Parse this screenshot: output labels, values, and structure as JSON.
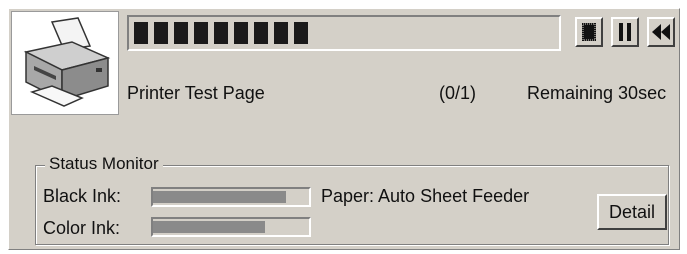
{
  "job": {
    "progress_fraction": 0.42,
    "progress_segments": 9,
    "title": "Printer Test Page",
    "count": "(0/1)",
    "remaining": "Remaining 30sec"
  },
  "controls": {
    "stop_icon": "stop-icon",
    "pause_icon": "pause-icon",
    "rewind_icon": "rewind-icon"
  },
  "status_monitor": {
    "title": "Status Monitor",
    "black_ink_label": "Black Ink:",
    "black_ink_level": 0.85,
    "color_ink_label": "Color Ink:",
    "color_ink_level": 0.72,
    "paper": "Paper: Auto Sheet Feeder",
    "detail_label": "Detail"
  },
  "colors": {
    "window_bg": "#d4d0c8",
    "progress_segment": "#1a1a1a",
    "ink_fill": "#8a8a8a"
  }
}
